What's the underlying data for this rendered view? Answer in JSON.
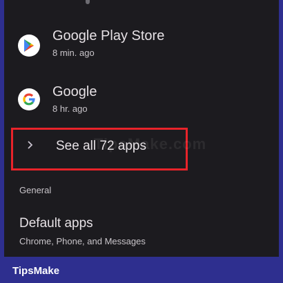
{
  "apps": [
    {
      "name": "Google Play Store",
      "time": "8 min. ago",
      "icon": "play-store-icon"
    },
    {
      "name": "Google",
      "time": "8 hr. ago",
      "icon": "google-g-icon"
    }
  ],
  "see_all": {
    "label": "See all 72 apps",
    "icon": "chevron-right-icon"
  },
  "watermark": "TipsMake.com",
  "general": {
    "header": "General",
    "default_apps": {
      "title": "Default apps",
      "subtitle": "Chrome, Phone, and Messages"
    }
  },
  "footer": {
    "brand": "TipsMake"
  },
  "colors": {
    "frame": "#2e2f8f",
    "screen": "#1c1b1f",
    "highlight": "#e8232a",
    "text_primary": "#e6e1e5",
    "text_secondary": "#c9c5ca"
  }
}
